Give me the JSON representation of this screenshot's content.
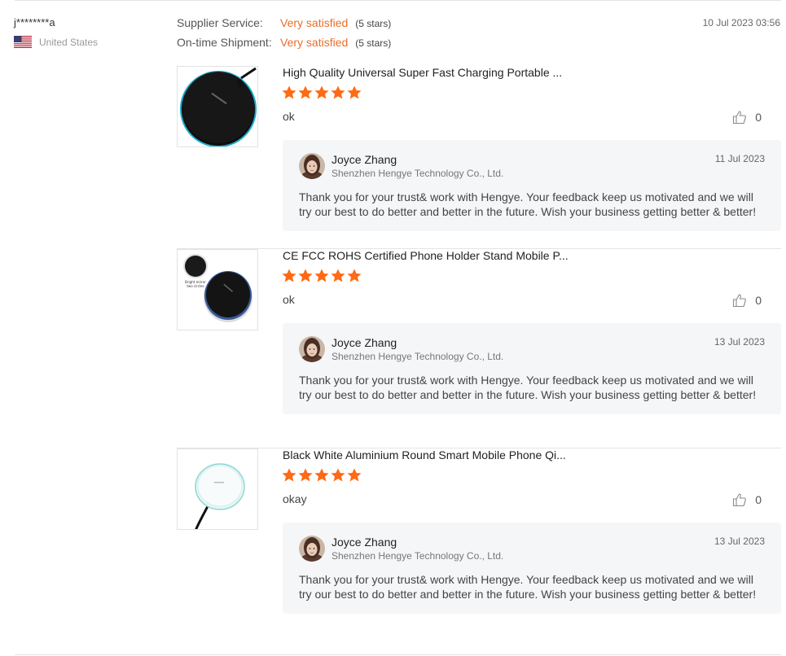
{
  "buyer": {
    "name": "j********a",
    "country": "United States",
    "flag_icon": "us-flag-icon"
  },
  "ratings": [
    {
      "label": "Supplier Service:",
      "value": "Very satisfied",
      "stars": "(5 stars)"
    },
    {
      "label": "On-time Shipment:",
      "value": "Very satisfied",
      "stars": "(5 stars)"
    }
  ],
  "review_date": "10 Jul 2023 03:56",
  "colors": {
    "accent": "#e96d2b",
    "star": "#ff6a14",
    "reply_bg": "#f5f6f7"
  },
  "reviews": [
    {
      "product_title": "High Quality Universal Super Fast Charging Portable ...",
      "rating": 5,
      "comment": "ok",
      "likes": "0",
      "reply": {
        "name": "Joyce Zhang",
        "company": "Shenzhen Hengye Technology Co., Ltd.",
        "date": "11 Jul 2023",
        "text": "Thank you for your trust& work with Hengye. Your feedback keep us motivated and we will try our best to do better and better in the future. Wish your business getting better & better!"
      }
    },
    {
      "product_title": "CE FCC ROHS Certified Phone Holder Stand Mobile P...",
      "rating": 5,
      "comment": "ok",
      "likes": "0",
      "reply": {
        "name": "Joyce Zhang",
        "company": "Shenzhen Hengye Technology Co., Ltd.",
        "date": "13 Jul 2023",
        "text": "Thank you for your trust& work with Hengye. Your feedback keep us motivated and we will try our best to do better and better in the future. Wish your business getting better & better!"
      }
    },
    {
      "product_title": "Black White Aluminium Round Smart Mobile Phone Qi...",
      "rating": 5,
      "comment": "okay",
      "likes": "0",
      "reply": {
        "name": "Joyce Zhang",
        "company": "Shenzhen Hengye Technology Co., Ltd.",
        "date": "13 Jul 2023",
        "text": "Thank you for your trust& work with Hengye. Your feedback keep us motivated and we will try our best to do better and better in the future. Wish your business getting better & better!"
      }
    }
  ]
}
